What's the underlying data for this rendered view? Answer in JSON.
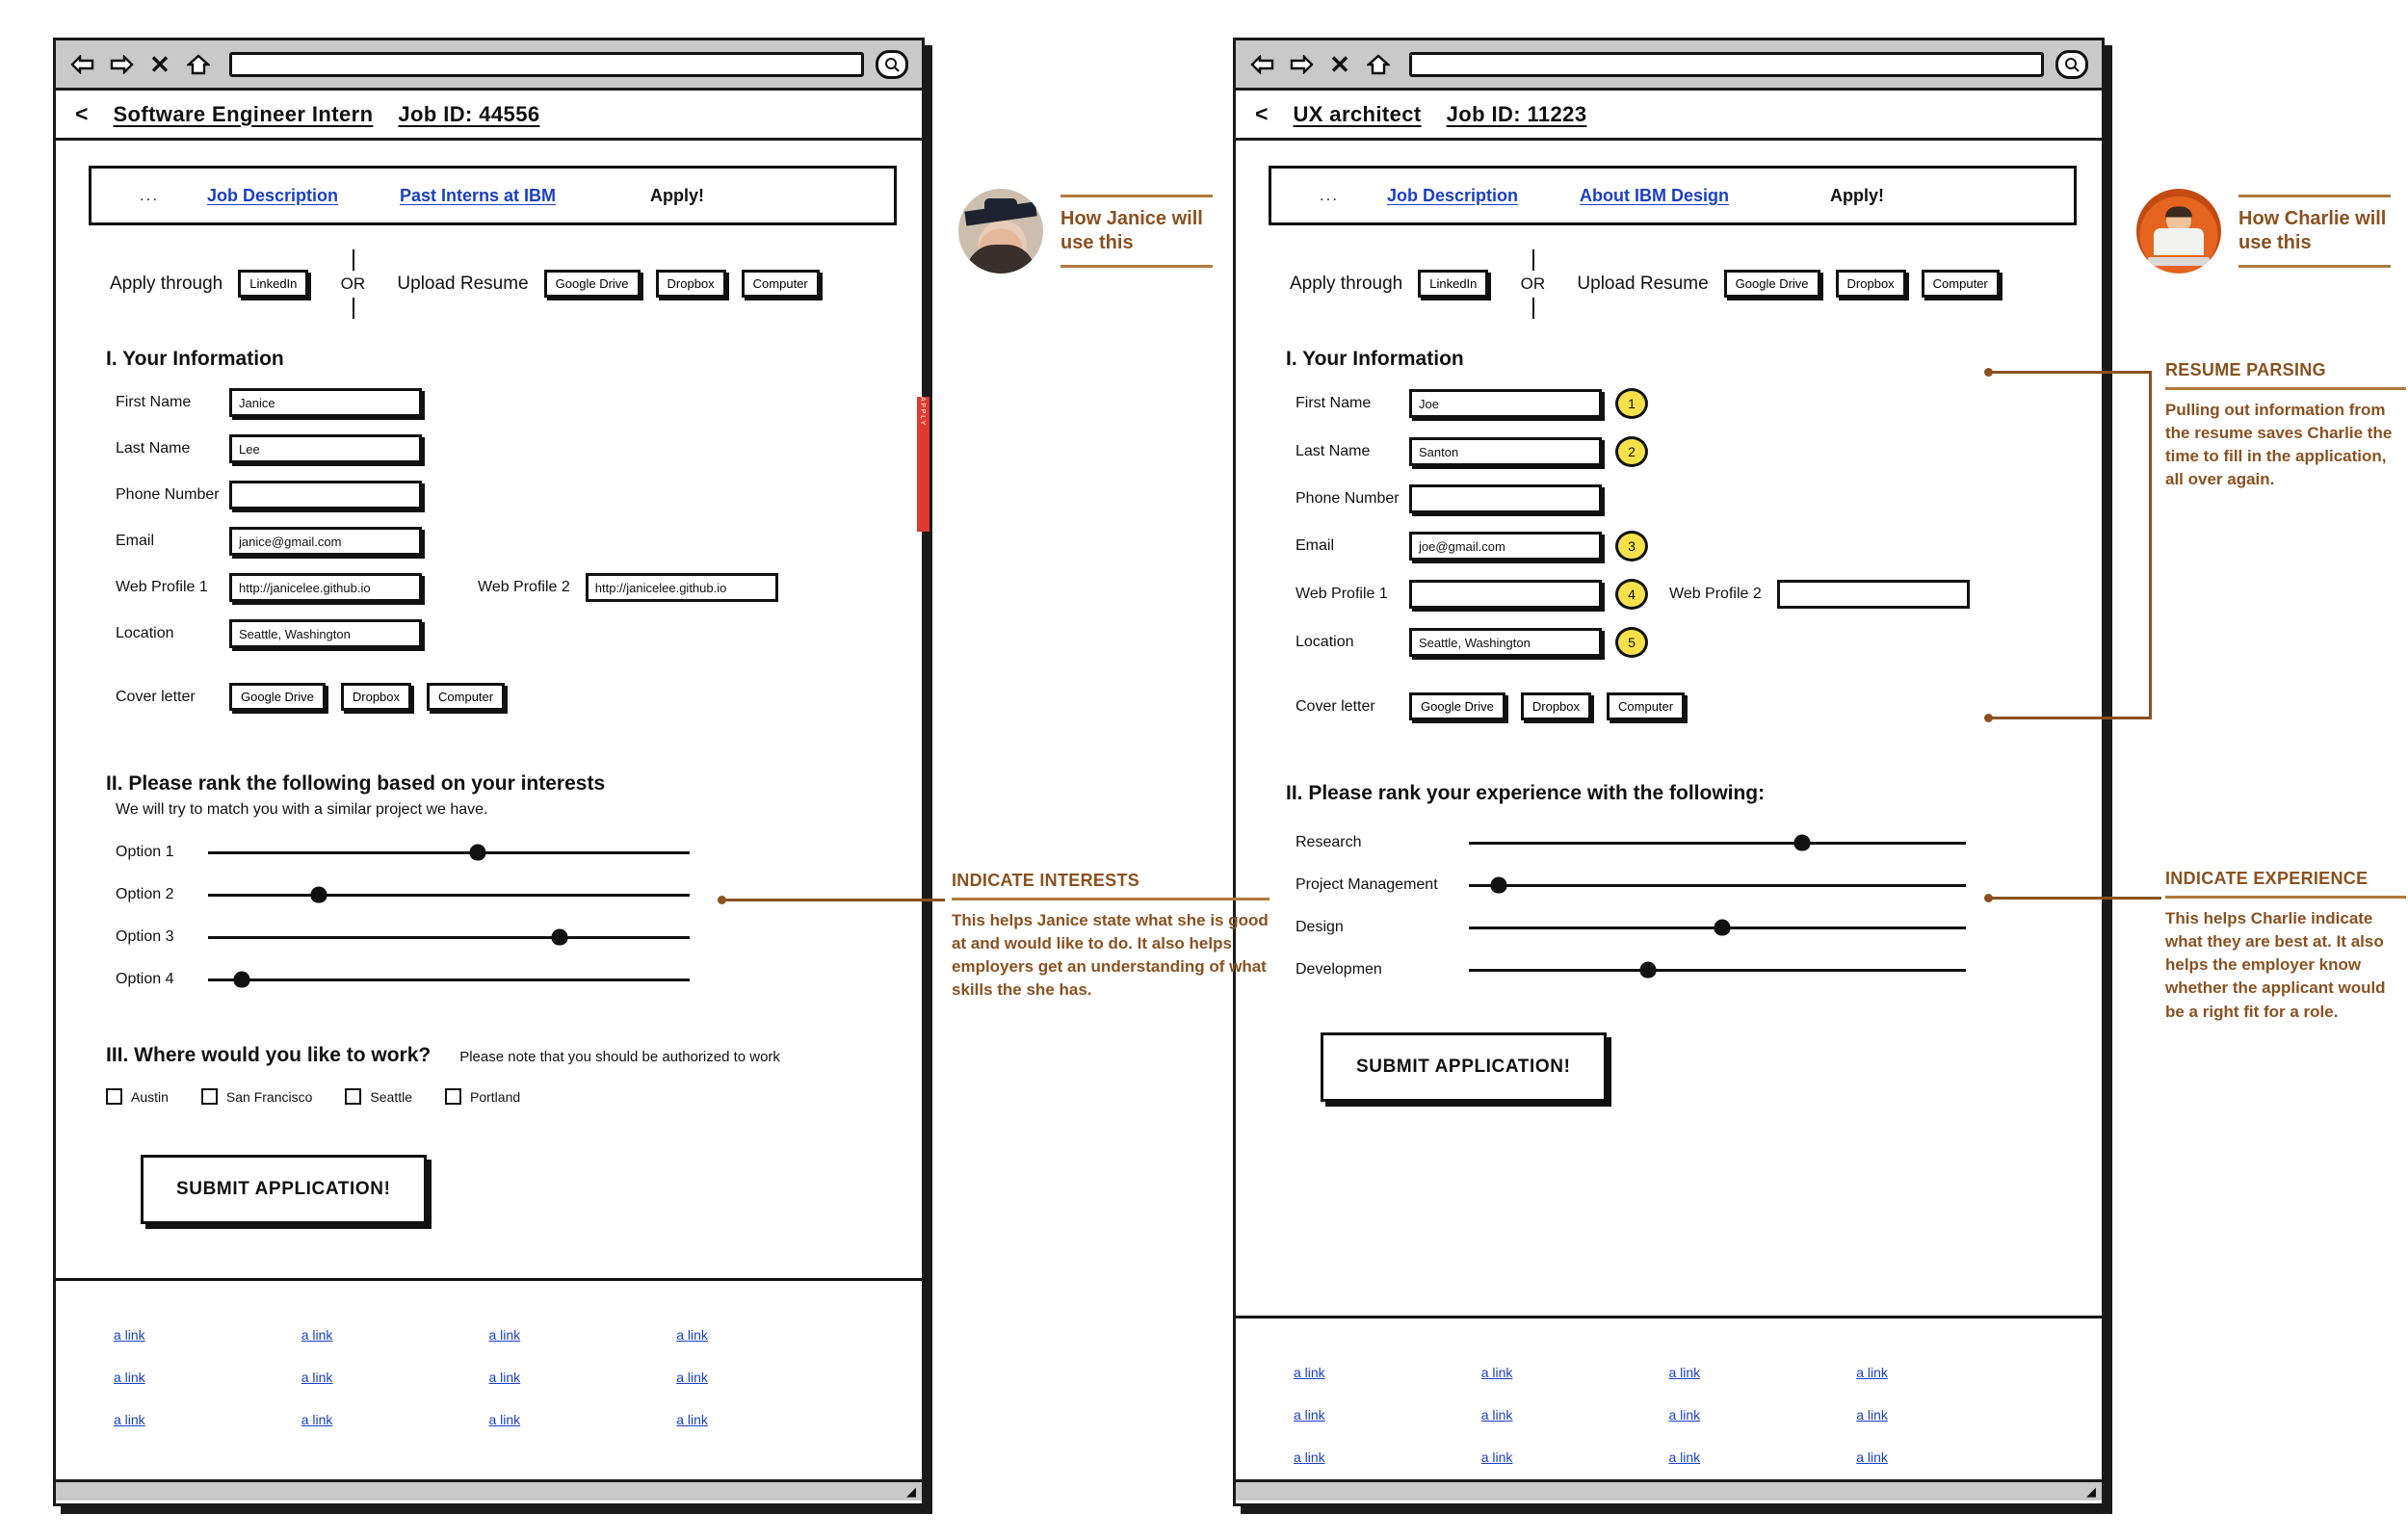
{
  "panels": [
    {
      "id": "left",
      "chrome": {
        "back": "⇦",
        "forward": "⇨",
        "close": "✕",
        "home": "⌂",
        "zoom": "⌕"
      },
      "titlebar": {
        "back": "<",
        "job_title": "Software Engineer Intern",
        "job_id": "Job ID: 44556"
      },
      "nav": {
        "dots": "...",
        "links": [
          "Job Description",
          "Past Interns at IBM"
        ],
        "apply": "Apply!"
      },
      "apply_row": {
        "apply_through_label": "Apply through",
        "apply_through_buttons": [
          "LinkedIn"
        ],
        "or": "OR",
        "upload_label": "Upload Resume",
        "upload_buttons": [
          "Google Drive",
          "Dropbox",
          "Computer"
        ]
      },
      "section1": {
        "heading": "I. Your Information",
        "fields": [
          {
            "label": "First Name",
            "value": "Janice",
            "badge": null
          },
          {
            "label": "Last Name",
            "value": "Lee",
            "badge": null
          },
          {
            "label": "Phone Number",
            "value": "",
            "badge": null
          },
          {
            "label": "Email",
            "value": "janice@gmail.com",
            "badge": null
          },
          {
            "label": "Web Profile 1",
            "value": "http://janicelee.github.io",
            "badge": null,
            "label2": "Web Profile 2",
            "value2": "http://janicelee.github.io"
          },
          {
            "label": "Location",
            "value": "Seattle, Washington",
            "badge": null
          }
        ],
        "cover_letter_label": "Cover letter",
        "cover_letter_buttons": [
          "Google Drive",
          "Dropbox",
          "Computer"
        ]
      },
      "section2": {
        "heading": "II. Please rank the following based on your interests",
        "subheading": "We will try to match you with a similar project we have.",
        "sliders": [
          {
            "label": "Option 1",
            "value": 56
          },
          {
            "label": "Option 2",
            "value": 23
          },
          {
            "label": "Option 3",
            "value": 73
          },
          {
            "label": "Option 4",
            "value": 7
          }
        ]
      },
      "section3": {
        "heading": "III. Where would you like to work?",
        "note": "Please note that you should be authorized to work",
        "checkboxes": [
          "Austin",
          "San Francisco",
          "Seattle",
          "Portland"
        ]
      },
      "submit_label": "SUBMIT APPLICATION!",
      "footer_link_label": "a link",
      "footer_rows": 3,
      "footer_cols": 4,
      "red_strip_text": "A P P L Y"
    },
    {
      "id": "right",
      "chrome": {
        "back": "⇦",
        "forward": "⇨",
        "close": "✕",
        "home": "⌂",
        "zoom": "⌕"
      },
      "titlebar": {
        "back": "<",
        "job_title": "UX architect",
        "job_id": "Job ID: 11223"
      },
      "nav": {
        "dots": "...",
        "links": [
          "Job Description",
          "About IBM Design"
        ],
        "apply": "Apply!"
      },
      "apply_row": {
        "apply_through_label": "Apply through",
        "apply_through_buttons": [
          "LinkedIn"
        ],
        "or": "OR",
        "upload_label": "Upload Resume",
        "upload_buttons": [
          "Google Drive",
          "Dropbox",
          "Computer"
        ]
      },
      "section1": {
        "heading": "I. Your Information",
        "fields": [
          {
            "label": "First Name",
            "value": "Joe",
            "badge": "1"
          },
          {
            "label": "Last Name",
            "value": "Santon",
            "badge": "2"
          },
          {
            "label": "Phone Number",
            "value": "",
            "badge": null
          },
          {
            "label": "Email",
            "value": "joe@gmail.com",
            "badge": "3"
          },
          {
            "label": "Web Profile 1",
            "value": "",
            "badge": "4",
            "label2": "Web Profile 2",
            "value2": ""
          },
          {
            "label": "Location",
            "value": "Seattle, Washington",
            "badge": "5"
          }
        ],
        "cover_letter_label": "Cover letter",
        "cover_letter_buttons": [
          "Google Drive",
          "Dropbox",
          "Computer"
        ]
      },
      "section2": {
        "heading": "II. Please rank your experience with the following:",
        "subheading": "",
        "sliders": [
          {
            "label": "Research",
            "value": 67
          },
          {
            "label": "Project Management",
            "value": 6
          },
          {
            "label": "Design",
            "value": 51
          },
          {
            "label": "Developmen",
            "value": 36
          }
        ]
      },
      "submit_label": "SUBMIT APPLICATION!",
      "footer_link_label": "a link",
      "footer_rows": 3,
      "footer_cols": 4
    }
  ],
  "annotations": {
    "persona_left": {
      "name": "How Janice will use this"
    },
    "persona_right": {
      "name": "How Charlie will use this"
    },
    "callouts": [
      {
        "id": "indicate-interests",
        "title": "INDICATE INTERESTS",
        "body": "This helps Janice state what she is good at and would like to do. It also helps employers get an understanding of what skills the she has."
      },
      {
        "id": "resume-parsing",
        "title": "RESUME PARSING",
        "body": "Pulling out information from the resume saves Charlie the time to fill in the application, all over again."
      },
      {
        "id": "indicate-experience",
        "title": "INDICATE EXPERIENCE",
        "body": "This helps Charlie indicate what they are best at. It also helps the employer know whether the applicant would be a right fit for a role."
      }
    ]
  },
  "colors": {
    "accent": "#8a5120",
    "rule": "#b07a3c",
    "link": "#1a3fc4",
    "badge": "#f7e14a",
    "chrome": "#c9c9c9"
  }
}
